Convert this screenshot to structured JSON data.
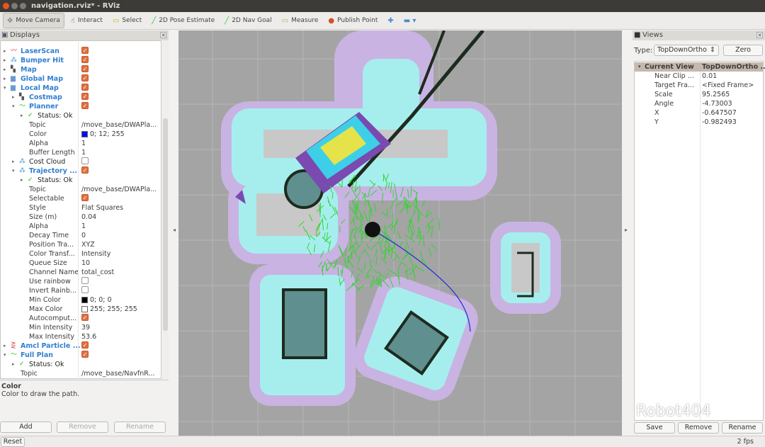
{
  "window": {
    "title": "navigation.rviz* - RViz"
  },
  "toolbar": {
    "tools": [
      {
        "label": "Move Camera",
        "icon": "move-camera-icon",
        "glyph": "✥",
        "color": "#888",
        "active": true
      },
      {
        "label": "Interact",
        "icon": "hand-icon",
        "glyph": "☝",
        "color": "#555"
      },
      {
        "label": "Select",
        "icon": "select-icon",
        "glyph": "▭",
        "color": "#c9b400"
      },
      {
        "label": "2D Pose Estimate",
        "icon": "pose-arrow-icon",
        "glyph": "╱",
        "color": "#2ecc40"
      },
      {
        "label": "2D Nav Goal",
        "icon": "nav-goal-arrow-icon",
        "glyph": "╱",
        "color": "#2ecc40"
      },
      {
        "label": "Measure",
        "icon": "ruler-icon",
        "glyph": "▭",
        "color": "#b8a060"
      },
      {
        "label": "Publish Point",
        "icon": "map-pin-icon",
        "glyph": "●",
        "color": "#d0502a"
      },
      {
        "label": "",
        "icon": "add-tool-icon",
        "glyph": "✚",
        "color": "#4a8ad0"
      },
      {
        "label": "",
        "icon": "remove-tool-icon",
        "glyph": "▬ ▾",
        "color": "#4a8ad0"
      }
    ]
  },
  "displays": {
    "title": "Displays",
    "rows": [
      {
        "lvl": 0,
        "arrow": "▸",
        "icon": "laserscan-icon",
        "glyph": "〰",
        "ic": "#d33",
        "name": "LaserScan",
        "bold": true,
        "check": true
      },
      {
        "lvl": 0,
        "arrow": "▸",
        "icon": "bumper-icon",
        "glyph": "⁂",
        "ic": "#3a8fd0",
        "name": "Bumper Hit",
        "bold": true,
        "check": true
      },
      {
        "lvl": 0,
        "arrow": "▸",
        "icon": "map-icon",
        "glyph": "▚",
        "ic": "#555",
        "name": "Map",
        "bold": true,
        "check": true
      },
      {
        "lvl": 0,
        "arrow": "▸",
        "icon": "folder-icon",
        "glyph": "▆",
        "ic": "#6a9ad0",
        "name": "Global Map",
        "bold": true,
        "check": true
      },
      {
        "lvl": 0,
        "arrow": "▾",
        "icon": "folder-icon",
        "glyph": "▆",
        "ic": "#6a9ad0",
        "name": "Local Map",
        "bold": true,
        "check": true
      },
      {
        "lvl": 1,
        "arrow": "▸",
        "icon": "map-icon",
        "glyph": "▚",
        "ic": "#555",
        "name": "Costmap",
        "bold": true,
        "check": true
      },
      {
        "lvl": 1,
        "arrow": "▾",
        "icon": "path-icon",
        "glyph": "〜",
        "ic": "#2c2",
        "name": "Planner",
        "bold": true,
        "check": true
      },
      {
        "lvl": 2,
        "arrow": "▸",
        "icon": "check-icon",
        "glyph": "✓",
        "ic": "#2a2",
        "name": "Status: Ok",
        "status": true
      },
      {
        "lvl": 3,
        "name": "Topic",
        "value": "/move_base/DWAPla..."
      },
      {
        "lvl": 3,
        "name": "Color",
        "value": "0; 12; 255",
        "swatch": "#000cff"
      },
      {
        "lvl": 3,
        "name": "Alpha",
        "value": "1"
      },
      {
        "lvl": 3,
        "name": "Buffer Length",
        "value": "1"
      },
      {
        "lvl": 1,
        "arrow": "▸",
        "icon": "pointcloud-icon",
        "glyph": "⁂",
        "ic": "#3a8fd0",
        "name": "Cost Cloud",
        "status": true,
        "check": false
      },
      {
        "lvl": 1,
        "arrow": "▾",
        "icon": "pointcloud-icon",
        "glyph": "⁂",
        "ic": "#3a8fd0",
        "name": "Trajectory ...",
        "bold": true,
        "check": true
      },
      {
        "lvl": 2,
        "arrow": "▸",
        "icon": "check-icon",
        "glyph": "✓",
        "ic": "#2a2",
        "name": "Status: Ok",
        "status": true
      },
      {
        "lvl": 3,
        "name": "Topic",
        "value": "/move_base/DWAPla..."
      },
      {
        "lvl": 3,
        "name": "Selectable",
        "check": true
      },
      {
        "lvl": 3,
        "name": "Style",
        "value": "Flat Squares"
      },
      {
        "lvl": 3,
        "name": "Size (m)",
        "value": "0.04"
      },
      {
        "lvl": 3,
        "name": "Alpha",
        "value": "1"
      },
      {
        "lvl": 3,
        "name": "Decay Time",
        "value": "0"
      },
      {
        "lvl": 3,
        "name": "Position Tra...",
        "value": "XYZ"
      },
      {
        "lvl": 3,
        "name": "Color Transf...",
        "value": "Intensity"
      },
      {
        "lvl": 3,
        "name": "Queue Size",
        "value": "10"
      },
      {
        "lvl": 3,
        "name": "Channel Name",
        "value": "total_cost"
      },
      {
        "lvl": 3,
        "name": "Use rainbow",
        "check": false
      },
      {
        "lvl": 3,
        "name": "Invert Rainb...",
        "check": false
      },
      {
        "lvl": 3,
        "name": "Min Color",
        "value": "0; 0; 0",
        "swatch": "#000000"
      },
      {
        "lvl": 3,
        "name": "Max Color",
        "value": "255; 255; 255",
        "swatch": "#ffffff"
      },
      {
        "lvl": 3,
        "name": "Autocomput...",
        "check": true
      },
      {
        "lvl": 3,
        "name": "Min Intensity",
        "value": "39"
      },
      {
        "lvl": 3,
        "name": "Max Intensity",
        "value": "53.6"
      },
      {
        "lvl": 0,
        "arrow": "▸",
        "icon": "particle-icon",
        "glyph": "⋛",
        "ic": "#d33",
        "name": "Amcl Particle ...",
        "bold": true,
        "check": true
      },
      {
        "lvl": 0,
        "arrow": "▾",
        "icon": "path-icon",
        "glyph": "〜",
        "ic": "#2c2",
        "name": "Full Plan",
        "bold": true,
        "check": true
      },
      {
        "lvl": 1,
        "arrow": "▸",
        "icon": "check-icon",
        "glyph": "✓",
        "ic": "#2a2",
        "name": "Status: Ok",
        "status": true
      },
      {
        "lvl": 2,
        "name": "Topic",
        "value": "/move_base/NavfnR..."
      }
    ],
    "description": {
      "title": "Color",
      "text": "Color to draw the path."
    },
    "buttons": {
      "add": "Add",
      "remove": "Remove",
      "rename": "Rename"
    }
  },
  "views": {
    "title": "Views",
    "type_label": "Type:",
    "type_value": "TopDownOrtho",
    "zero": "Zero",
    "header": {
      "name": "Current View",
      "value": "TopDownOrtho ..."
    },
    "rows": [
      {
        "name": "Near Clip ...",
        "value": "0.01"
      },
      {
        "name": "Target Fra...",
        "value": "<Fixed Frame>"
      },
      {
        "name": "Scale",
        "value": "95.2565"
      },
      {
        "name": "Angle",
        "value": "-4.73003"
      },
      {
        "name": "X",
        "value": "-0.647507"
      },
      {
        "name": "Y",
        "value": "-0.982493"
      }
    ],
    "buttons": {
      "save": "Save",
      "remove": "Remove",
      "rename": "Rename"
    }
  },
  "statusbar": {
    "reset": "Reset",
    "fps": "2 fps"
  },
  "watermark": "Robot404"
}
